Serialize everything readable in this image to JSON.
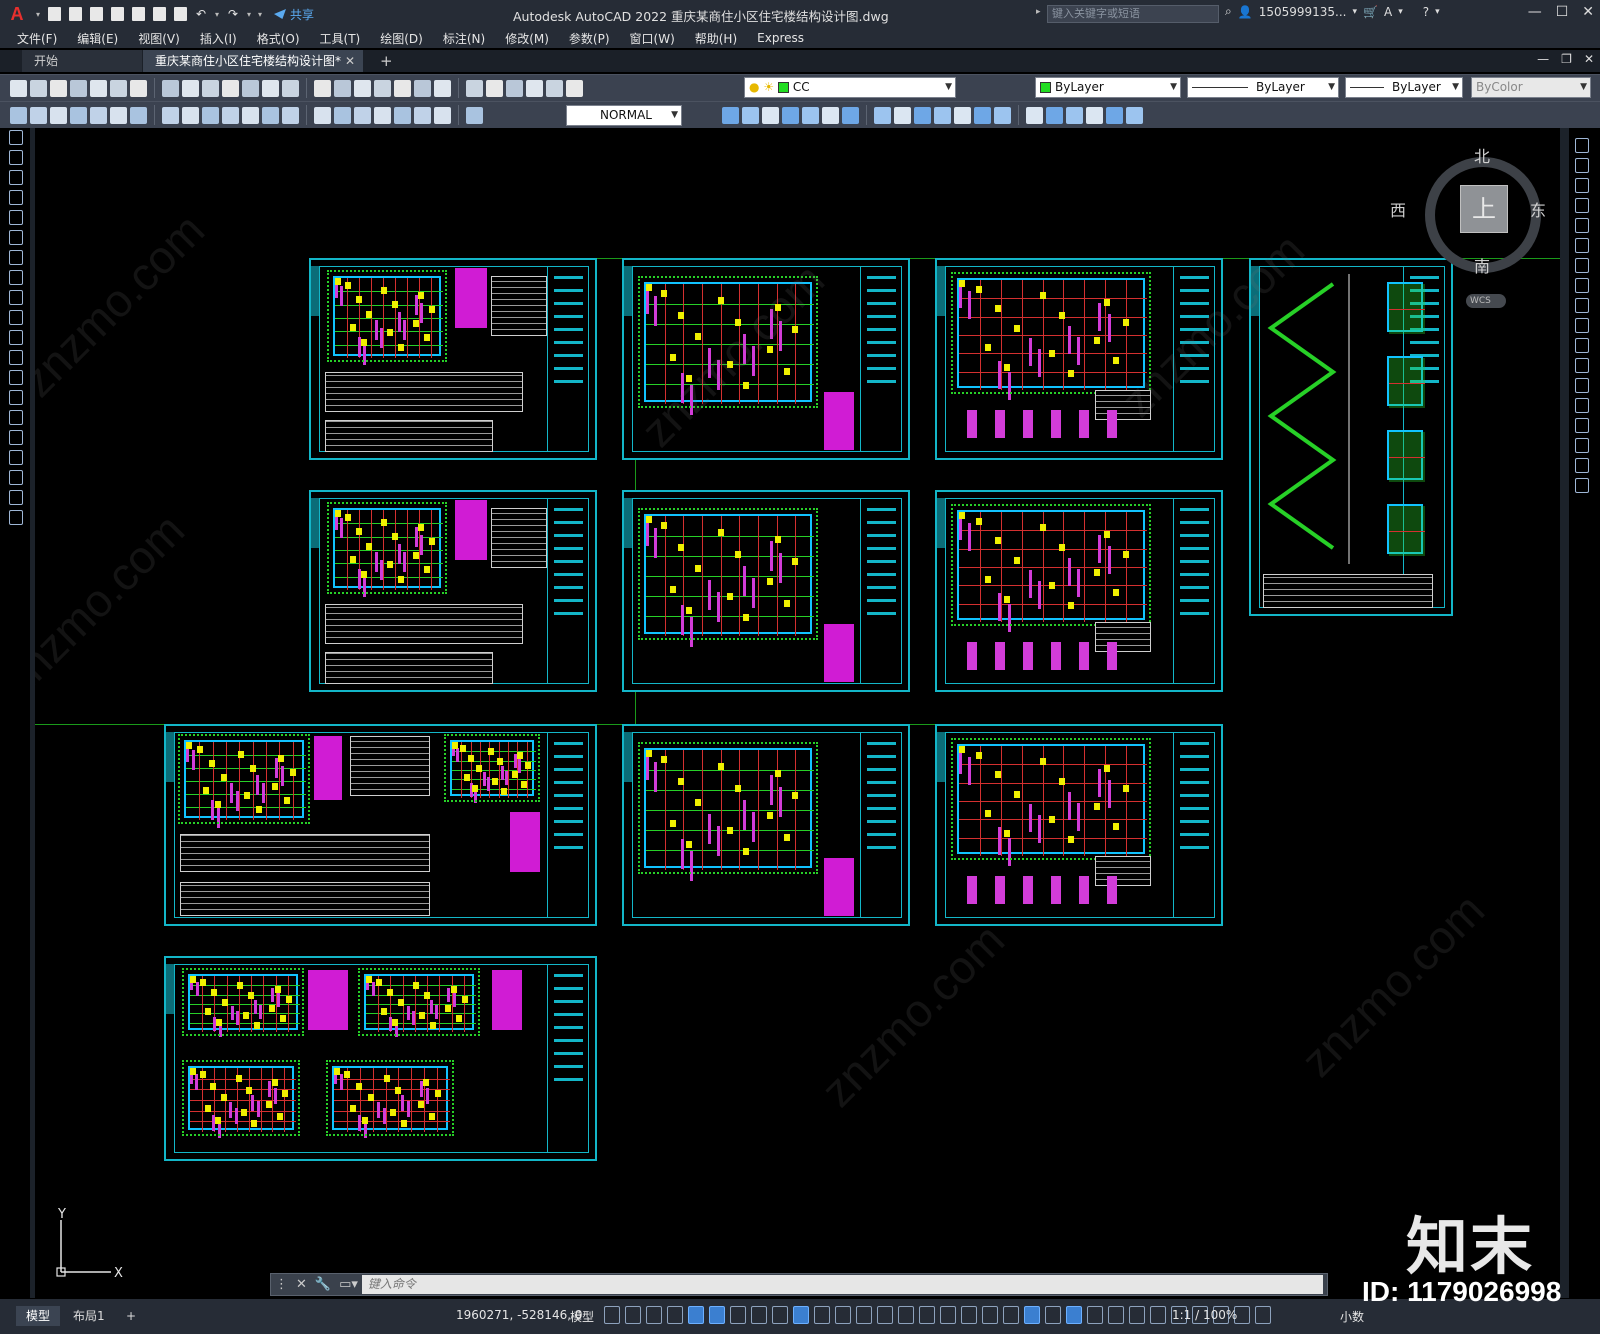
{
  "app": {
    "logo_letter": "A",
    "title": "Autodesk AutoCAD 2022    重庆某商住小区住宅楼结构设计图.dwg",
    "share_label": "共享",
    "search_placeholder": "键入关键字或短语",
    "user": "1505999135...",
    "help": "?"
  },
  "menu": [
    "文件(F)",
    "编辑(E)",
    "视图(V)",
    "插入(I)",
    "格式(O)",
    "工具(T)",
    "绘图(D)",
    "标注(N)",
    "修改(M)",
    "参数(P)",
    "窗口(W)",
    "帮助(H)",
    "Express"
  ],
  "tabs": {
    "start": "开始",
    "document": "重庆某商住小区住宅楼结构设计图*",
    "close": "✕",
    "add": "+"
  },
  "toolbar": {
    "layer": "CC",
    "color": "ByLayer",
    "linetype": "ByLayer",
    "lineweight": "ByLayer",
    "plotstyle": "ByColor",
    "dimstyle": "NORMAL"
  },
  "viewcube": {
    "north": "北",
    "south": "南",
    "east": "东",
    "west": "西",
    "top": "上",
    "wcs": "WCS"
  },
  "ucs": {
    "x": "X",
    "y": "Y"
  },
  "command": {
    "placeholder": "键入命令"
  },
  "status": {
    "tab_model": "模型",
    "tab_layout1": "布局1",
    "tab_add": "+",
    "coordinates": "1960271, -528146, 0",
    "space": "模型",
    "annotation_scale": "1:1 / 100%",
    "units": "小数"
  },
  "watermark": {
    "logo": "知末",
    "id": "ID: 1179026998",
    "site": "znzmo.com"
  },
  "colors": {
    "sheet_border": "#13b6c8",
    "axis_grid": "#d43030",
    "beam_magenta": "#d23cd8",
    "beam_green": "#27d027",
    "column_yellow": "#f0f000",
    "layer_swatch": "#22dd22"
  }
}
